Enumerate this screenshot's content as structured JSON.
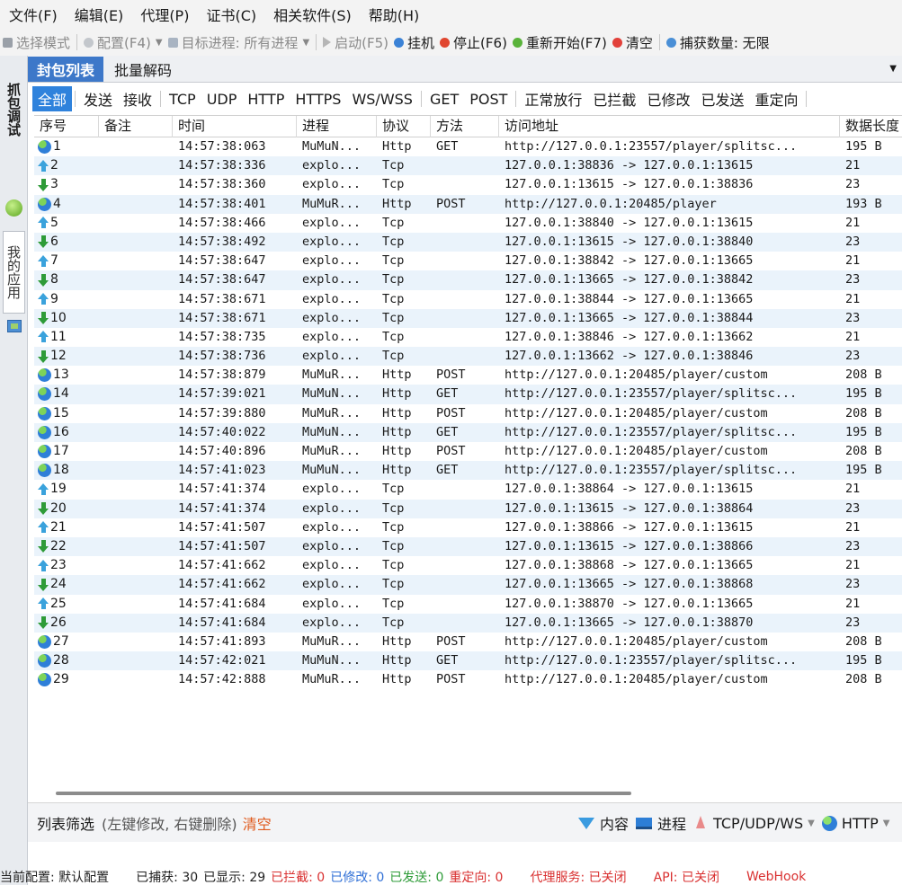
{
  "menu": {
    "items": [
      "文件(F)",
      "编辑(E)",
      "代理(P)",
      "证书(C)",
      "相关软件(S)",
      "帮助(H)"
    ]
  },
  "toolbar": {
    "select_mode": "选择模式",
    "config": "配置(F4)",
    "target_process": "目标进程: 所有进程",
    "start": "启动(F5)",
    "hang": "挂机",
    "stop": "停止(F6)",
    "restart": "重新开始(F7)",
    "clear": "清空",
    "capture_count": "捕获数量: 无限"
  },
  "left_strip": {
    "capture_tab": "抓包调试",
    "apps_tab": "我的应用"
  },
  "tabs": {
    "packet_list": "封包列表",
    "batch_decode": "批量解码"
  },
  "filters": [
    "全部",
    "发送",
    "接收",
    "TCP",
    "UDP",
    "HTTP",
    "HTTPS",
    "WS/WSS",
    "GET",
    "POST",
    "正常放行",
    "已拦截",
    "已修改",
    "已发送",
    "重定向"
  ],
  "grid": {
    "columns": {
      "no": "序号",
      "note": "备注",
      "time": "时间",
      "process": "进程",
      "protocol": "协议",
      "method": "方法",
      "url": "访问地址",
      "length": "数据长度"
    },
    "rows": [
      {
        "icon": "globe",
        "no": "1",
        "time": "14:57:38:063",
        "process": "MuMuN...",
        "protocol": "Http",
        "method": "GET",
        "url": "http://127.0.0.1:23557/player/splitsc...",
        "length": "195 B"
      },
      {
        "icon": "up",
        "no": "2",
        "time": "14:57:38:336",
        "process": "explo...",
        "protocol": "Tcp",
        "method": "",
        "url": "127.0.0.1:38836 -> 127.0.0.1:13615",
        "length": "21"
      },
      {
        "icon": "down",
        "no": "3",
        "time": "14:57:38:360",
        "process": "explo...",
        "protocol": "Tcp",
        "method": "",
        "url": "127.0.0.1:13615 -> 127.0.0.1:38836",
        "length": "23"
      },
      {
        "icon": "globe",
        "no": "4",
        "time": "14:57:38:401",
        "process": "MuMuR...",
        "protocol": "Http",
        "method": "POST",
        "url": "http://127.0.0.1:20485/player",
        "length": "193 B"
      },
      {
        "icon": "up",
        "no": "5",
        "time": "14:57:38:466",
        "process": "explo...",
        "protocol": "Tcp",
        "method": "",
        "url": "127.0.0.1:38840 -> 127.0.0.1:13615",
        "length": "21"
      },
      {
        "icon": "down",
        "no": "6",
        "time": "14:57:38:492",
        "process": "explo...",
        "protocol": "Tcp",
        "method": "",
        "url": "127.0.0.1:13615 -> 127.0.0.1:38840",
        "length": "23"
      },
      {
        "icon": "up",
        "no": "7",
        "time": "14:57:38:647",
        "process": "explo...",
        "protocol": "Tcp",
        "method": "",
        "url": "127.0.0.1:38842 -> 127.0.0.1:13665",
        "length": "21"
      },
      {
        "icon": "down",
        "no": "8",
        "time": "14:57:38:647",
        "process": "explo...",
        "protocol": "Tcp",
        "method": "",
        "url": "127.0.0.1:13665 -> 127.0.0.1:38842",
        "length": "23"
      },
      {
        "icon": "up",
        "no": "9",
        "time": "14:57:38:671",
        "process": "explo...",
        "protocol": "Tcp",
        "method": "",
        "url": "127.0.0.1:38844 -> 127.0.0.1:13665",
        "length": "21"
      },
      {
        "icon": "down",
        "no": "10",
        "time": "14:57:38:671",
        "process": "explo...",
        "protocol": "Tcp",
        "method": "",
        "url": "127.0.0.1:13665 -> 127.0.0.1:38844",
        "length": "23"
      },
      {
        "icon": "up",
        "no": "11",
        "time": "14:57:38:735",
        "process": "explo...",
        "protocol": "Tcp",
        "method": "",
        "url": "127.0.0.1:38846 -> 127.0.0.1:13662",
        "length": "21"
      },
      {
        "icon": "down",
        "no": "12",
        "time": "14:57:38:736",
        "process": "explo...",
        "protocol": "Tcp",
        "method": "",
        "url": "127.0.0.1:13662 -> 127.0.0.1:38846",
        "length": "23"
      },
      {
        "icon": "globe",
        "no": "13",
        "time": "14:57:38:879",
        "process": "MuMuR...",
        "protocol": "Http",
        "method": "POST",
        "url": "http://127.0.0.1:20485/player/custom",
        "length": "208 B"
      },
      {
        "icon": "globe",
        "no": "14",
        "time": "14:57:39:021",
        "process": "MuMuN...",
        "protocol": "Http",
        "method": "GET",
        "url": "http://127.0.0.1:23557/player/splitsc...",
        "length": "195 B"
      },
      {
        "icon": "globe",
        "no": "15",
        "time": "14:57:39:880",
        "process": "MuMuR...",
        "protocol": "Http",
        "method": "POST",
        "url": "http://127.0.0.1:20485/player/custom",
        "length": "208 B"
      },
      {
        "icon": "globe",
        "no": "16",
        "time": "14:57:40:022",
        "process": "MuMuN...",
        "protocol": "Http",
        "method": "GET",
        "url": "http://127.0.0.1:23557/player/splitsc...",
        "length": "195 B"
      },
      {
        "icon": "globe",
        "no": "17",
        "time": "14:57:40:896",
        "process": "MuMuR...",
        "protocol": "Http",
        "method": "POST",
        "url": "http://127.0.0.1:20485/player/custom",
        "length": "208 B"
      },
      {
        "icon": "globe",
        "no": "18",
        "time": "14:57:41:023",
        "process": "MuMuN...",
        "protocol": "Http",
        "method": "GET",
        "url": "http://127.0.0.1:23557/player/splitsc...",
        "length": "195 B"
      },
      {
        "icon": "up",
        "no": "19",
        "time": "14:57:41:374",
        "process": "explo...",
        "protocol": "Tcp",
        "method": "",
        "url": "127.0.0.1:38864 -> 127.0.0.1:13615",
        "length": "21"
      },
      {
        "icon": "down",
        "no": "20",
        "time": "14:57:41:374",
        "process": "explo...",
        "protocol": "Tcp",
        "method": "",
        "url": "127.0.0.1:13615 -> 127.0.0.1:38864",
        "length": "23"
      },
      {
        "icon": "up",
        "no": "21",
        "time": "14:57:41:507",
        "process": "explo...",
        "protocol": "Tcp",
        "method": "",
        "url": "127.0.0.1:38866 -> 127.0.0.1:13615",
        "length": "21"
      },
      {
        "icon": "down",
        "no": "22",
        "time": "14:57:41:507",
        "process": "explo...",
        "protocol": "Tcp",
        "method": "",
        "url": "127.0.0.1:13615 -> 127.0.0.1:38866",
        "length": "23"
      },
      {
        "icon": "up",
        "no": "23",
        "time": "14:57:41:662",
        "process": "explo...",
        "protocol": "Tcp",
        "method": "",
        "url": "127.0.0.1:38868 -> 127.0.0.1:13665",
        "length": "21"
      },
      {
        "icon": "down",
        "no": "24",
        "time": "14:57:41:662",
        "process": "explo...",
        "protocol": "Tcp",
        "method": "",
        "url": "127.0.0.1:13665 -> 127.0.0.1:38868",
        "length": "23"
      },
      {
        "icon": "up",
        "no": "25",
        "time": "14:57:41:684",
        "process": "explo...",
        "protocol": "Tcp",
        "method": "",
        "url": "127.0.0.1:38870 -> 127.0.0.1:13665",
        "length": "21"
      },
      {
        "icon": "down",
        "no": "26",
        "time": "14:57:41:684",
        "process": "explo...",
        "protocol": "Tcp",
        "method": "",
        "url": "127.0.0.1:13665 -> 127.0.0.1:38870",
        "length": "23"
      },
      {
        "icon": "globe",
        "no": "27",
        "time": "14:57:41:893",
        "process": "MuMuR...",
        "protocol": "Http",
        "method": "POST",
        "url": "http://127.0.0.1:20485/player/custom",
        "length": "208 B"
      },
      {
        "icon": "globe",
        "no": "28",
        "time": "14:57:42:021",
        "process": "MuMuN...",
        "protocol": "Http",
        "method": "GET",
        "url": "http://127.0.0.1:23557/player/splitsc...",
        "length": "195 B"
      },
      {
        "icon": "globe",
        "no": "29",
        "time": "14:57:42:888",
        "process": "MuMuR...",
        "protocol": "Http",
        "method": "POST",
        "url": "http://127.0.0.1:20485/player/custom",
        "length": "208 B"
      }
    ]
  },
  "list_filter": {
    "title": "列表筛选",
    "hint": "(左键修改, 右键删除)",
    "clear": "清空",
    "content": "内容",
    "process": "进程",
    "tcp_udp_ws": "TCP/UDP/WS",
    "http": "HTTP"
  },
  "status": {
    "config": "当前配置: 默认配置",
    "captured": "已捕获: 30",
    "shown": "已显示: 29",
    "intercepted": "已拦截: 0",
    "modified": "已修改: 0",
    "sent": "已发送: 0",
    "redirected": "重定向: 0",
    "proxy": "代理服务: 已关闭",
    "api": "API: 已关闭",
    "web": "WebHook"
  },
  "colors": {
    "accent": "#3d78c9",
    "row_alt": "#eaf3fb",
    "clear": "#e05a1c",
    "status_red": "#d93030",
    "status_blue": "#2f6fd6",
    "status_green": "#2e9b38"
  }
}
